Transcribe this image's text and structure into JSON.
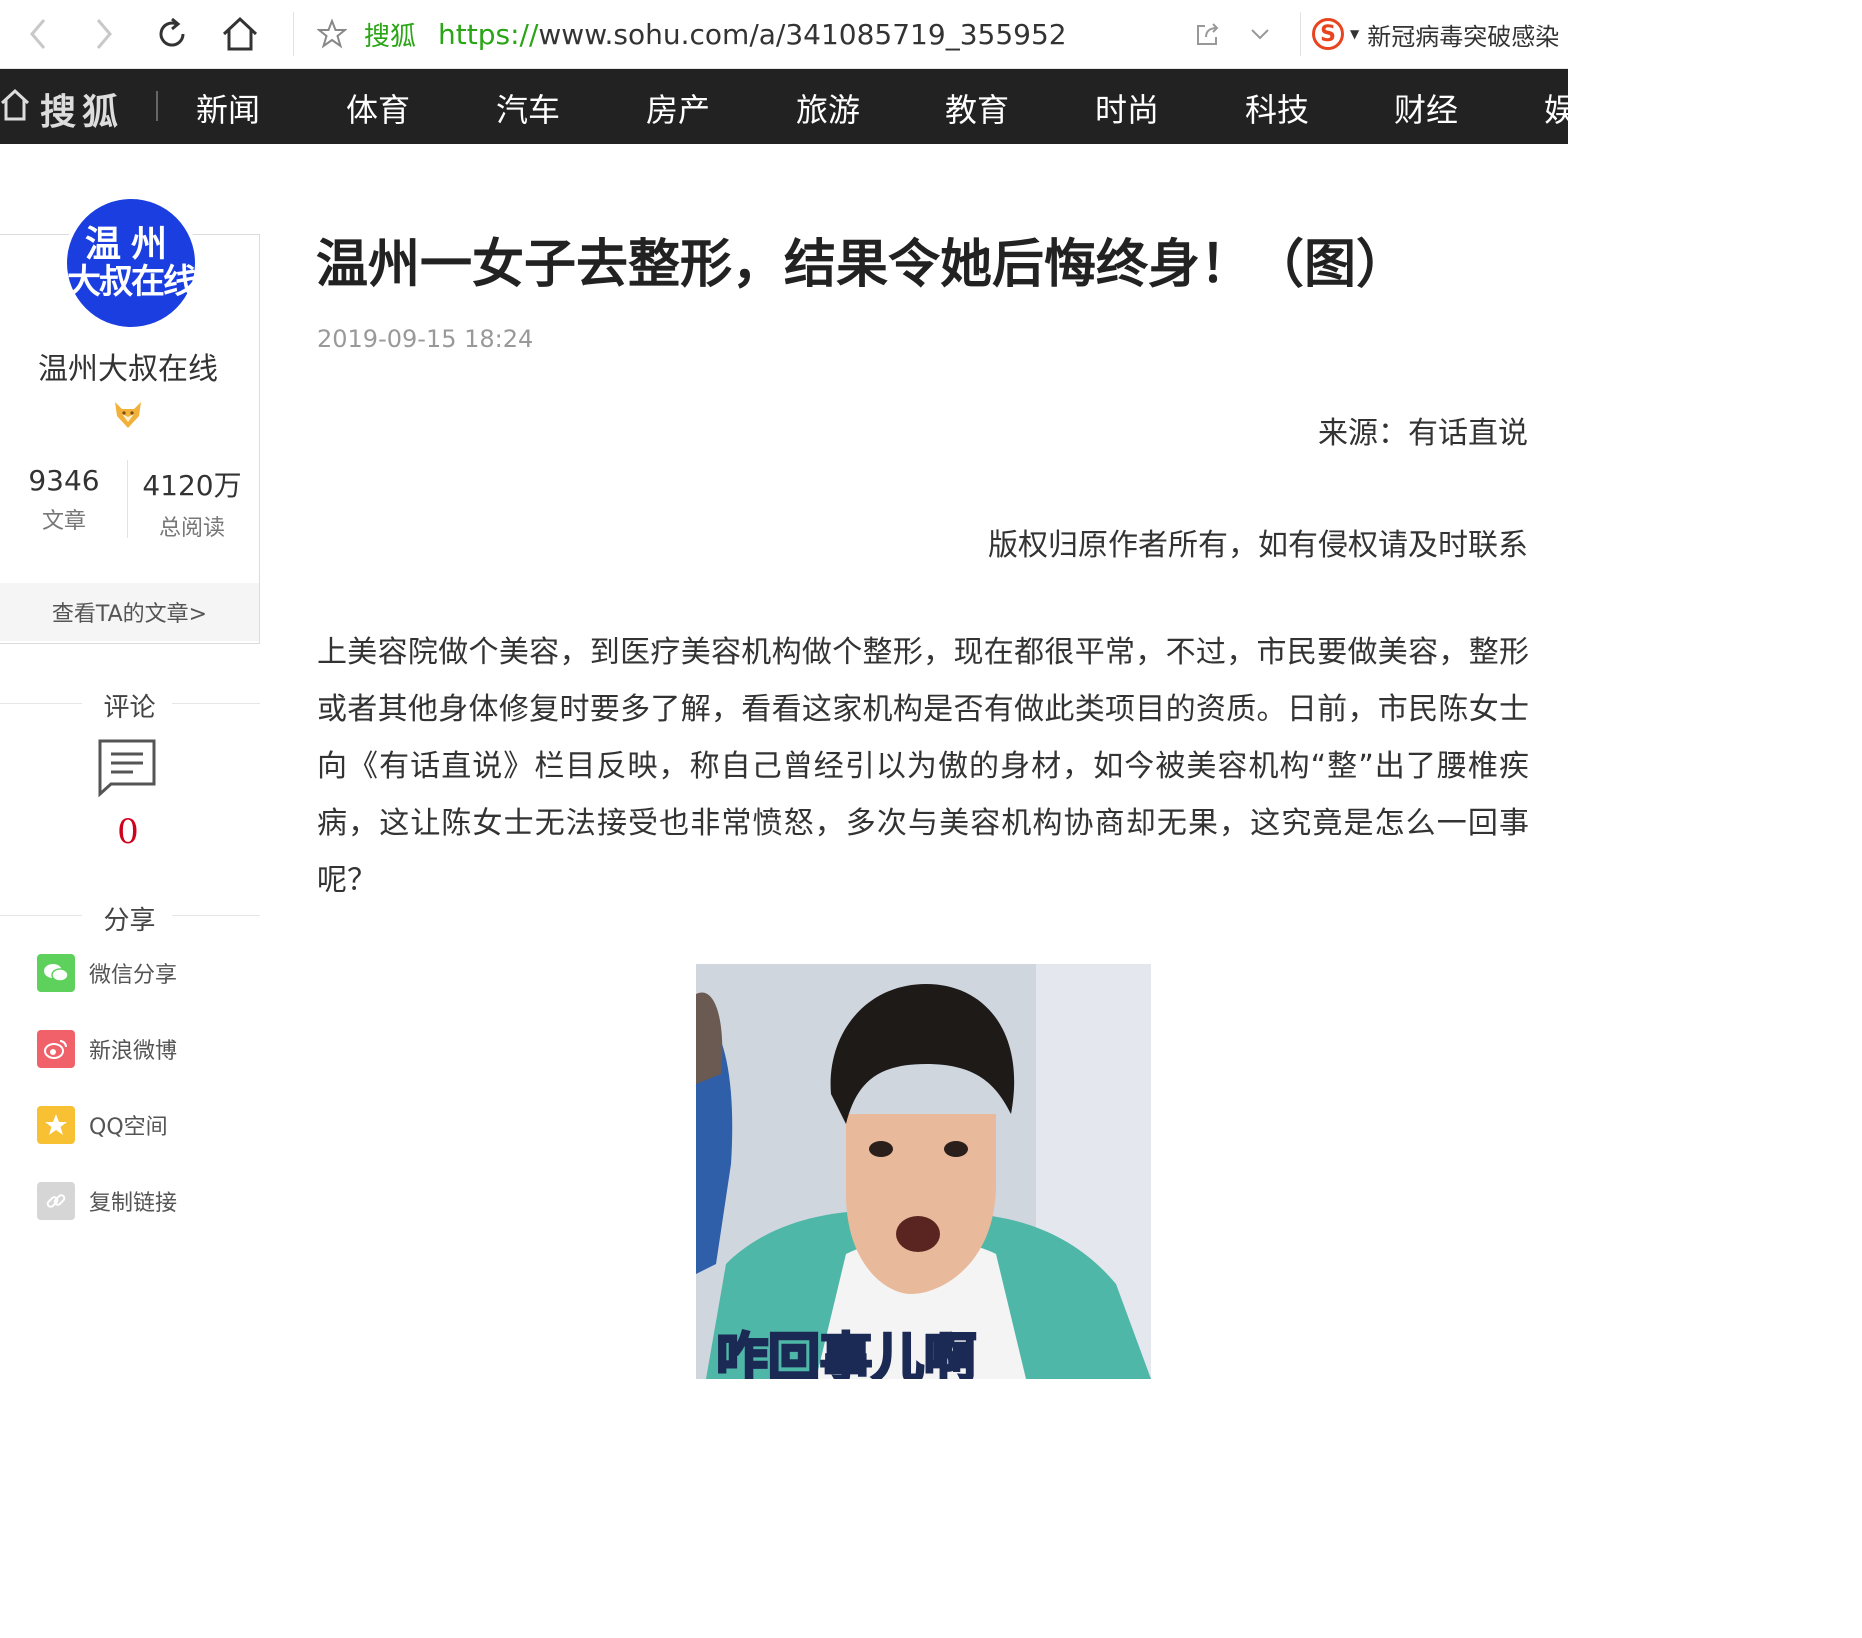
{
  "browser": {
    "site_name": "搜狐",
    "url_protocol": "https://",
    "url_rest": "www.sohu.com/a/341085719_355952",
    "search_hint": "新冠病毒突破感染"
  },
  "nav": {
    "brand": "搜狐",
    "items": [
      "新闻",
      "体育",
      "汽车",
      "房产",
      "旅游",
      "教育",
      "时尚",
      "科技",
      "财经",
      "娱"
    ]
  },
  "author": {
    "avatar_line1": "温州",
    "avatar_line2": "大叔在线",
    "name": "温州大叔在线",
    "articles_count": "9346",
    "articles_label": "文章",
    "reads_count": "4120万",
    "reads_label": "总阅读",
    "view_articles_label": "查看TA的文章>"
  },
  "comments": {
    "title": "评论",
    "count": "0"
  },
  "share": {
    "title": "分享",
    "items": [
      {
        "label": "微信分享",
        "icon": "wechat-icon",
        "color": "#5ed15c"
      },
      {
        "label": "新浪微博",
        "icon": "weibo-icon",
        "color": "#f0616a"
      },
      {
        "label": "QQ空间",
        "icon": "qzone-icon",
        "color": "#f8c033"
      },
      {
        "label": "复制链接",
        "icon": "link-icon",
        "color": "#d6d6d6"
      }
    ]
  },
  "article": {
    "title": "温州一女子去整形，结果令她后悔终身！（图）",
    "date": "2019-09-15 18:24",
    "source": "来源：有话直说",
    "copyright": "版权归原作者所有，如有侵权请及时联系",
    "paragraph": "上美容院做个美容，到医疗美容机构做个整形，现在都很平常，不过，市民要做美容，整形或者其他身体修复时要多了解，看看这家机构是否有做此类项目的资质。日前，市民陈女士向《有话直说》栏目反映，称自己曾经引以为傲的身材，如今被美容机构“整”出了腰椎疾病，这让陈女士无法接受也非常愤怒，多次与美容机构协商却无果，这究竟是怎么一回事呢？",
    "image_caption": "咋回事儿啊"
  }
}
